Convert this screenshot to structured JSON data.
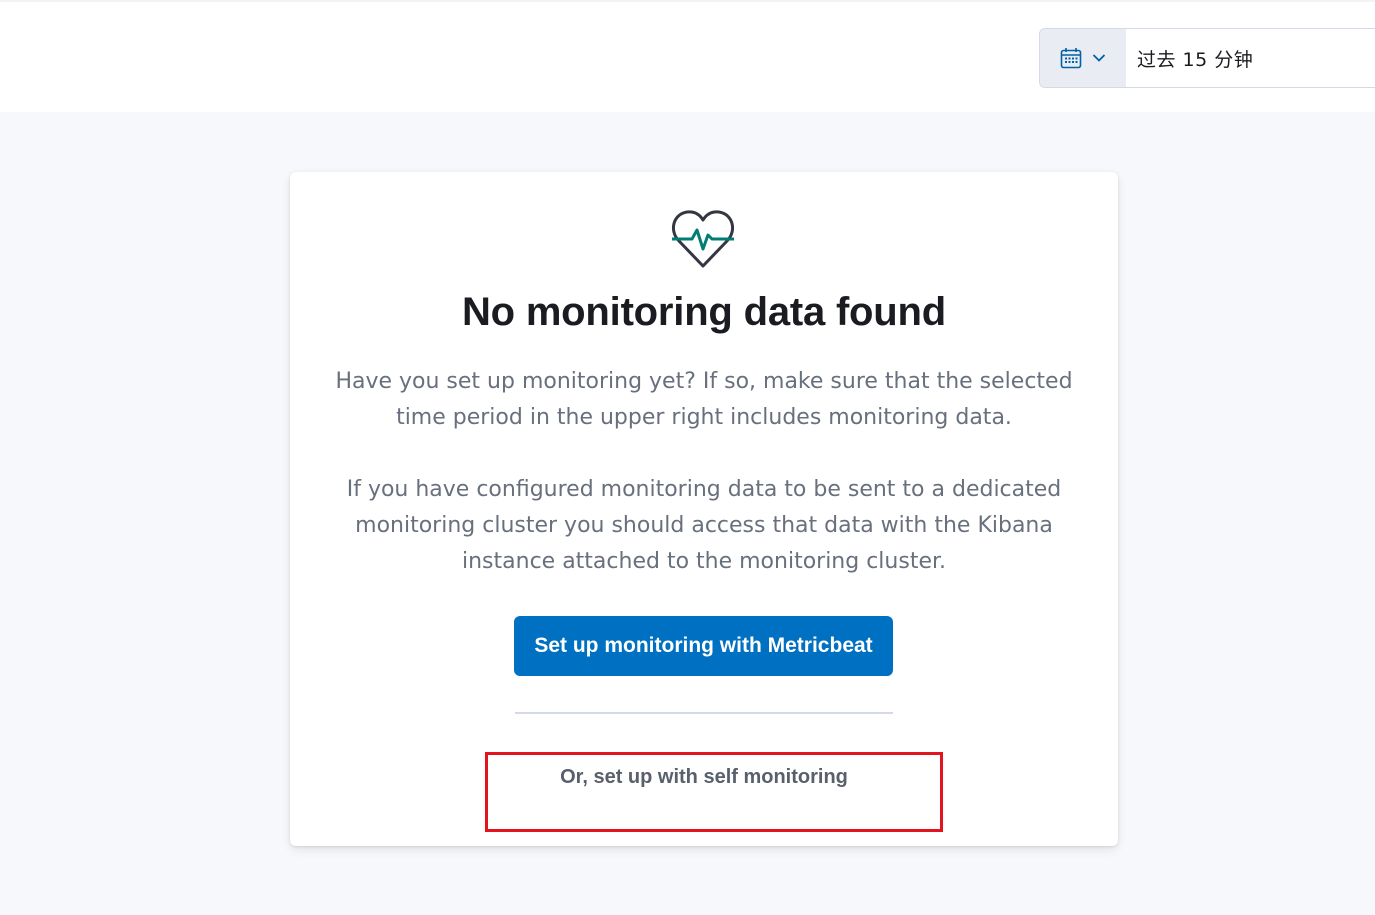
{
  "header": {
    "date_picker": {
      "quick_menu_icon": "calendar-icon",
      "chevron_icon": "chevron-down-icon",
      "value": "过去 15 分钟"
    }
  },
  "empty_state": {
    "icon": "heartbeat-icon",
    "title": "No monitoring data found",
    "paragraphs": [
      "Have you set up monitoring yet? If so, make sure that the selected time period in the upper right includes monitoring data.",
      "If you have configured monitoring data to be sent to a dedicated monitoring cluster you should access that data with the Kibana instance attached to the monitoring cluster."
    ],
    "primary_button_label": "Set up monitoring with Metricbeat",
    "secondary_link_label": "Or, set up with self monitoring"
  },
  "colors": {
    "primary": "#0071c2",
    "accent_teal": "#017d73",
    "highlight_red": "#e3141d",
    "text_title": "#1a1c21",
    "text_body": "#69707d"
  }
}
